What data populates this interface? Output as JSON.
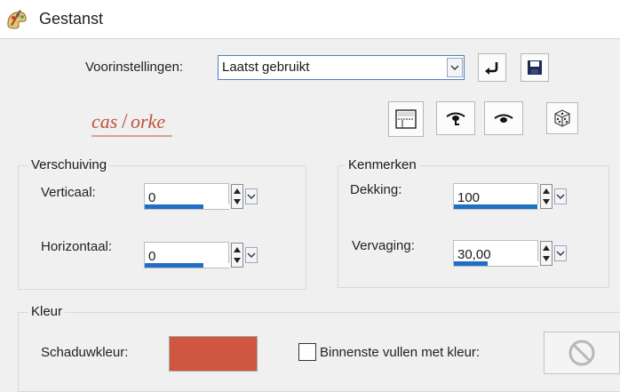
{
  "window": {
    "title": "Gestanst"
  },
  "presets": {
    "label": "Voorinstellingen:",
    "value": "Laatst gebruikt"
  },
  "logo": {
    "text": "castorke"
  },
  "offset_group": {
    "title": "Verschuiving",
    "vertical": {
      "label": "Verticaal:",
      "value": "0",
      "fill": 0.7
    },
    "horizontal": {
      "label": "Horizontaal:",
      "value": "0",
      "fill": 0.7
    }
  },
  "props_group": {
    "title": "Kenmerken",
    "opacity": {
      "label": "Dekking:",
      "value": "100",
      "fill": 1.0
    },
    "blur": {
      "label": "Vervaging:",
      "value": "30,00",
      "fill": 0.4
    }
  },
  "color_group": {
    "title": "Kleur",
    "shadow_label": "Schaduwkleur:",
    "shadow_color": "#d0573f",
    "fill_inside_label": "Binnenste vullen met kleur:",
    "fill_inside_checked": false
  },
  "icons": {
    "title": "paint-palette-icon",
    "reset": "reset-arrow-icon",
    "save": "floppy-disk-icon",
    "proof": "preview-window-icon",
    "auto_proof": "auto-proof-eye-icon",
    "proof_eye": "eye-icon",
    "randomize": "dice-icon",
    "no_color": "no-symbol-icon"
  }
}
